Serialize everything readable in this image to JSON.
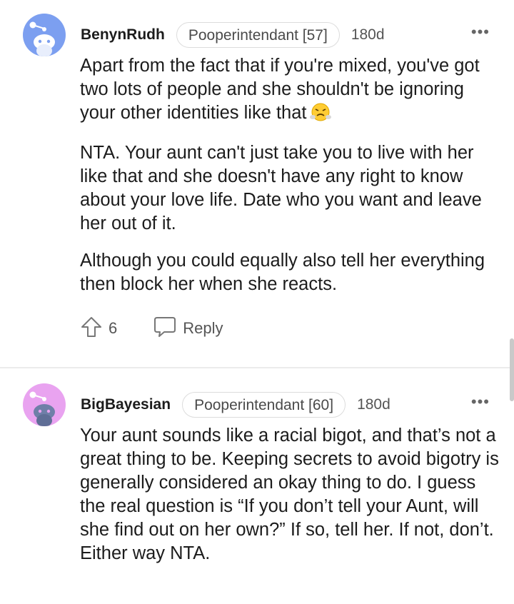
{
  "comments": [
    {
      "username": "BenynRudh",
      "flair": "Pooperintendant [57]",
      "age": "180d",
      "avatar_color": "#7c9ff0",
      "paragraphs": [
        "Apart from the fact that if you're mixed, you've got two lots of people and she shouldn't be ignoring your other identities like that",
        "NTA. Your aunt can't just take you to live with her like that and she doesn't have any right to know about your love life. Date who you want and leave her out of it.",
        "Although you could equally also tell her everything then block her when she reacts."
      ],
      "emoji": "face-with-steam-icon",
      "votes": "6",
      "reply_label": "Reply"
    },
    {
      "username": "BigBayesian",
      "flair": "Pooperintendant [60]",
      "age": "180d",
      "avatar_color": "#e9a3f0",
      "paragraphs": [
        "Your aunt sounds like a racial bigot, and that’s not a great thing to be. Keeping secrets to avoid bigotry is generally considered an okay thing to do. I guess the real question is “If you don’t tell your Aunt, will she find out on her own?” If so, tell her. If not, don’t. Either way NTA."
      ]
    }
  ],
  "more_label": "•••"
}
